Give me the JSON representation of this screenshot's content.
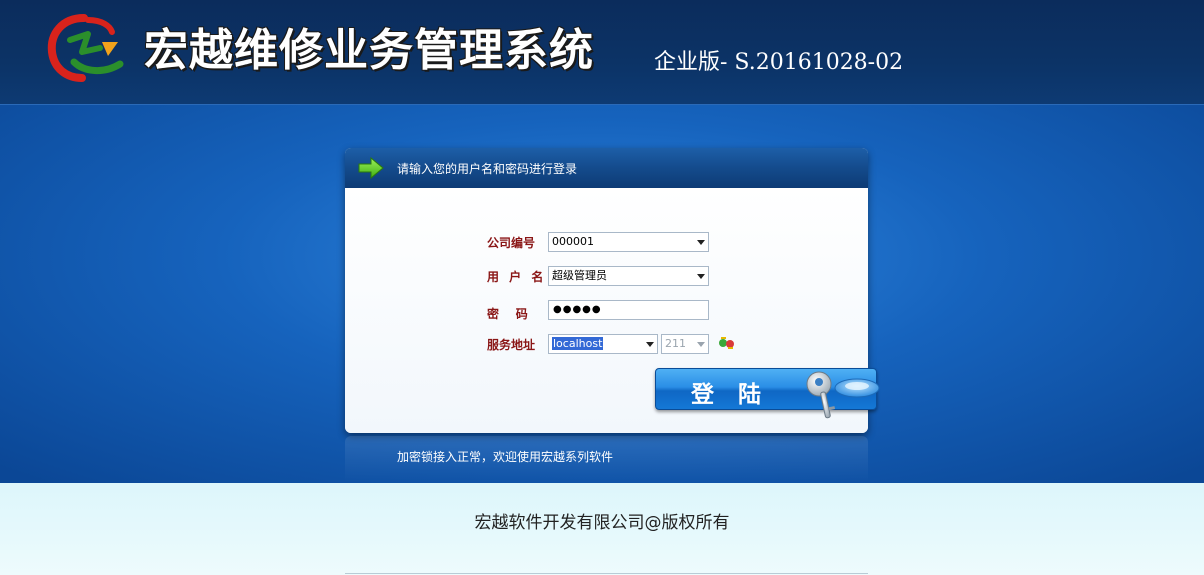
{
  "header": {
    "title": "宏越维修业务管理系统",
    "edition": "企业版- S.20161028-02",
    "logo_icon": "hongyue-logo-icon"
  },
  "login_panel": {
    "heading": "请输入您的用户名和密码进行登录",
    "fields": {
      "company_label": "公司编号",
      "company_value": "000001",
      "user_label": "用 户 名",
      "user_value": "超级管理员",
      "password_label": "密    码",
      "password_value": "●●●●●",
      "server_label": "服务地址",
      "server_value": "localhost",
      "port_value": "211"
    },
    "login_button": "登陆",
    "status": "加密锁接入正常，欢迎使用宏越系列软件"
  },
  "footer": {
    "copyright": "宏越软件开发有限公司@版权所有"
  },
  "colors": {
    "header_bg": "#0c3366",
    "main_bg": "#1663bd",
    "label_red": "#8a1616",
    "footer_bg": "#e6f9fc"
  }
}
